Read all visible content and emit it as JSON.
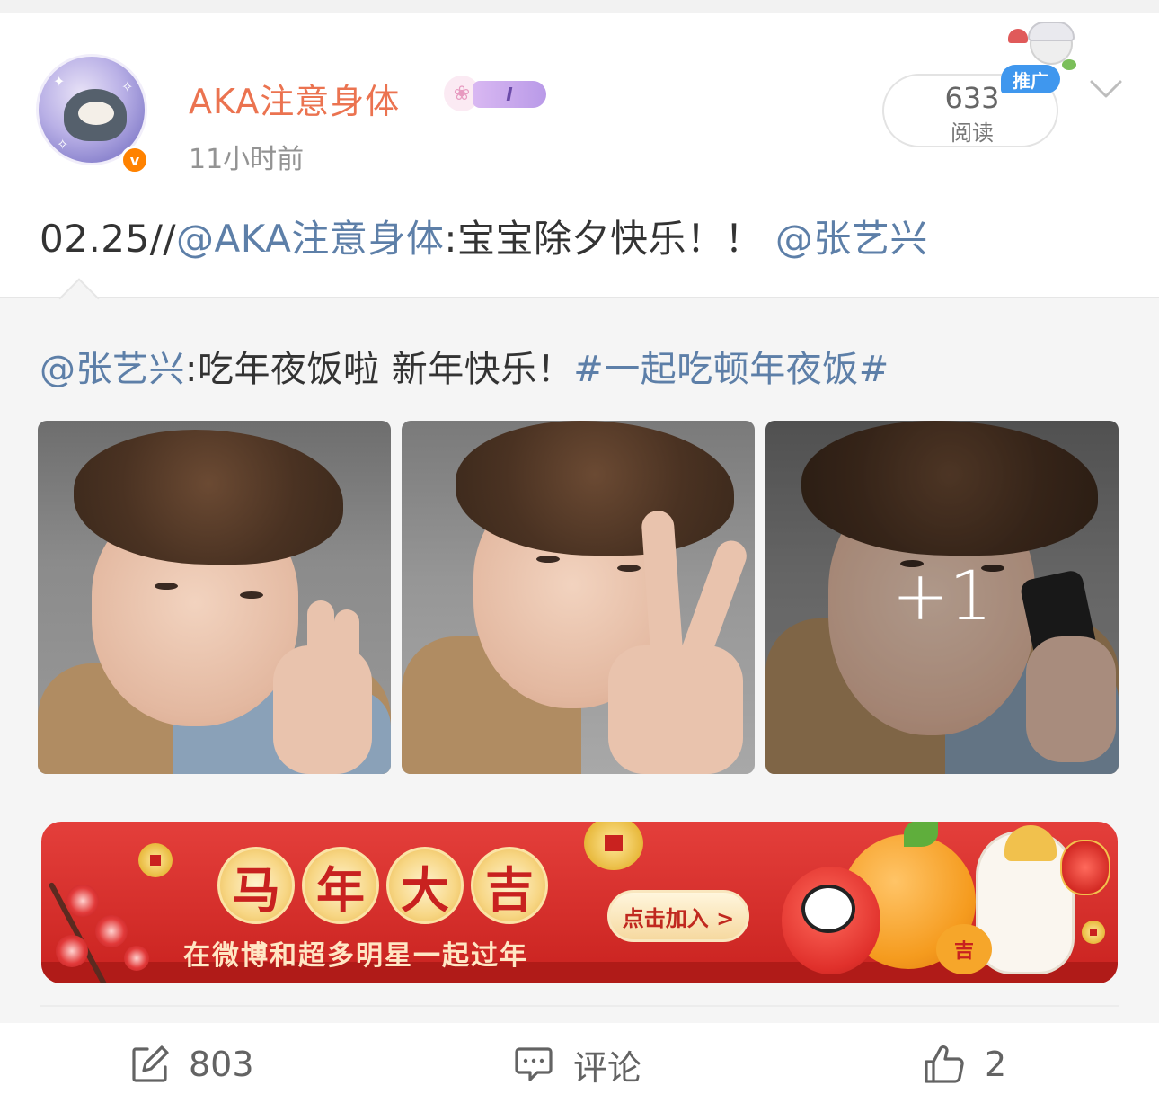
{
  "post": {
    "username": "AKA注意身体",
    "member_badge_text": "I",
    "timestamp": "11小时前",
    "read": {
      "count": "633",
      "label": "阅读"
    },
    "promo_badge": "推广",
    "text": {
      "date_prefix": "02.25//",
      "mention_author": "@AKA注意身体",
      "message": ":宝宝除夕快乐！！ ",
      "mention_target": "@张艺兴"
    }
  },
  "repost": {
    "mention": "@张艺兴",
    "message": ":吃年夜饭啦 新年快乐！",
    "hashtag": "#一起吃顿年夜饭#",
    "photos": [
      {
        "name": "photo-1"
      },
      {
        "name": "photo-2"
      },
      {
        "name": "photo-3",
        "more_count": "+1"
      }
    ]
  },
  "banner": {
    "title_chars": [
      "马",
      "年",
      "大",
      "吉"
    ],
    "subtitle": "在微博和超多明星一起过年",
    "button_label": "点击加入 >",
    "charm_char": "吉",
    "colors": {
      "background": "#d42f2b",
      "gold": "#f7d684"
    }
  },
  "actions": {
    "share_count": "803",
    "comment_label": "评论",
    "like_count": "2"
  },
  "icons": [
    "verified-icon",
    "chevron-down-icon",
    "share-icon",
    "comment-icon",
    "like-icon"
  ],
  "colors": {
    "username": "#eb7350",
    "link": "#5d7fa8",
    "verified": "#ff8200",
    "promo": "#3f97ee"
  }
}
